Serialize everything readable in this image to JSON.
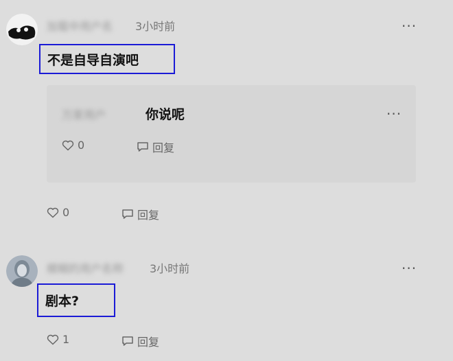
{
  "comments": [
    {
      "username": "加载中用户名",
      "time": "3小时前",
      "more": "···",
      "text": "不是自导自演吧",
      "like_count": "0",
      "reply_label": "回复",
      "reply": {
        "username": "万家用户",
        "text": "你说呢",
        "more": "···",
        "like_count": "0",
        "reply_label": "回复"
      }
    },
    {
      "username": "模糊的用户名称",
      "time": "3小时前",
      "more": "···",
      "text": "剧本?",
      "like_count": "1",
      "reply_label": "回复"
    }
  ],
  "icons": {
    "like": "heart-outline-icon",
    "reply": "speech-bubble-icon",
    "more": "more-dots-icon"
  },
  "colors": {
    "background": "#dddddd",
    "highlight_border": "#1a1ad6",
    "reply_card": "#d6d6d6"
  }
}
